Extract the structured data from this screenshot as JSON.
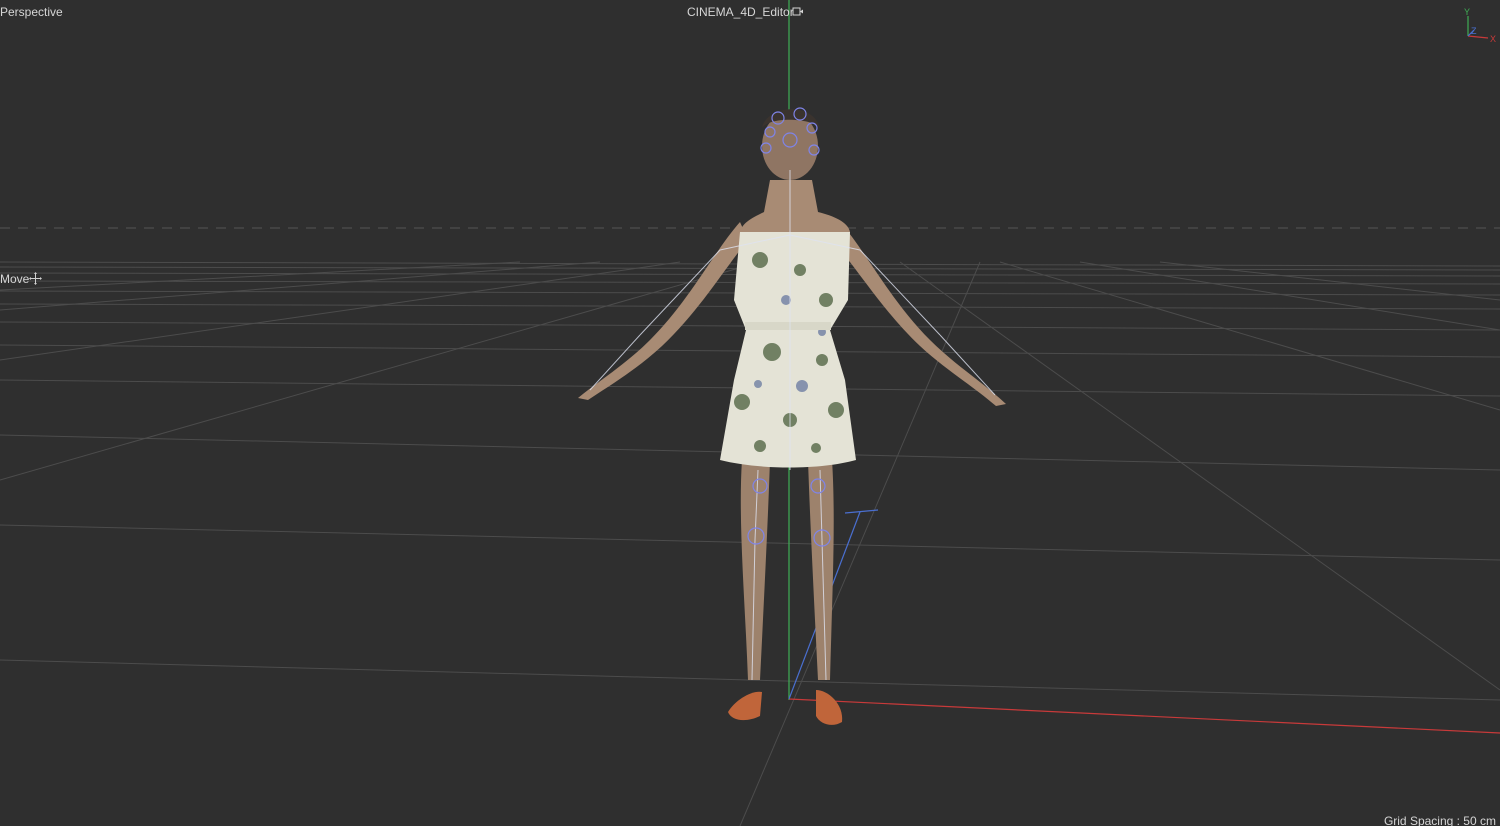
{
  "viewport": {
    "view_name": "Perspective",
    "camera_name": "CINEMA_4D_Editor",
    "tool_name": "Move",
    "grid_spacing": "Grid Spacing : 50 cm",
    "icons": {
      "camera": "camera-lock-icon",
      "move": "move-crosshair-icon"
    },
    "axis_labels": {
      "y": "Y",
      "z": "Z",
      "x": "X"
    },
    "colors": {
      "background": "#2f2f2f",
      "grid": "#4a4a4a",
      "axis_x": "#c83a3a",
      "axis_y": "#3fae55",
      "axis_z": "#4a6fd0",
      "hud_text": "#d6d6d6"
    }
  }
}
